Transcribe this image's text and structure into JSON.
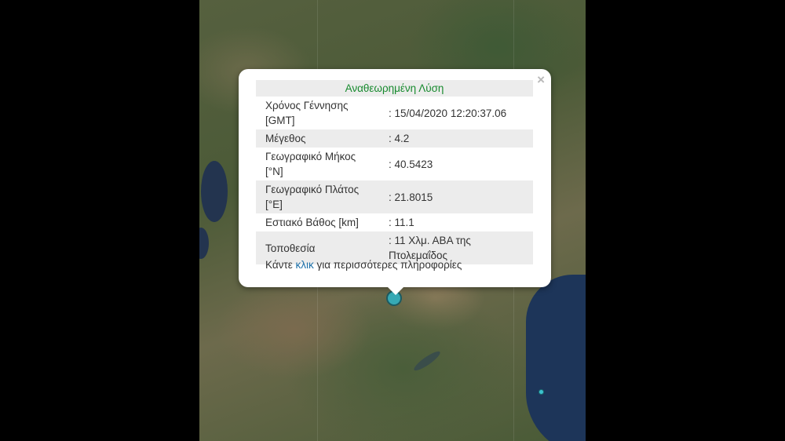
{
  "popup": {
    "title": "Αναθεωρημένη Λύση",
    "close_icon": "×",
    "rows": [
      {
        "label": "Χρόνος Γέννησης [GMT]",
        "value": ": 15/04/2020 12:20:37.06"
      },
      {
        "label": "Μέγεθος",
        "value": ": 4.2"
      },
      {
        "label": "Γεωγραφικό Μήκος [°N]",
        "value": ": 40.5423"
      },
      {
        "label": "Γεωγραφικό Πλάτος [°E]",
        "value": ": 21.8015"
      },
      {
        "label": "Εστιακό Βάθος [km]",
        "value": ": 11.1"
      },
      {
        "label": "Τοποθεσία",
        "value": ": 11 Χλμ. ΑΒΑ της Πτολεμαΐδος"
      }
    ],
    "footer": {
      "before": "Κάντε ",
      "link": "κλικ",
      "after": " για περισσότερες πληροφορίες"
    }
  },
  "map": {
    "marker_color": "#36a9b4",
    "water_color": "#1d3559"
  }
}
